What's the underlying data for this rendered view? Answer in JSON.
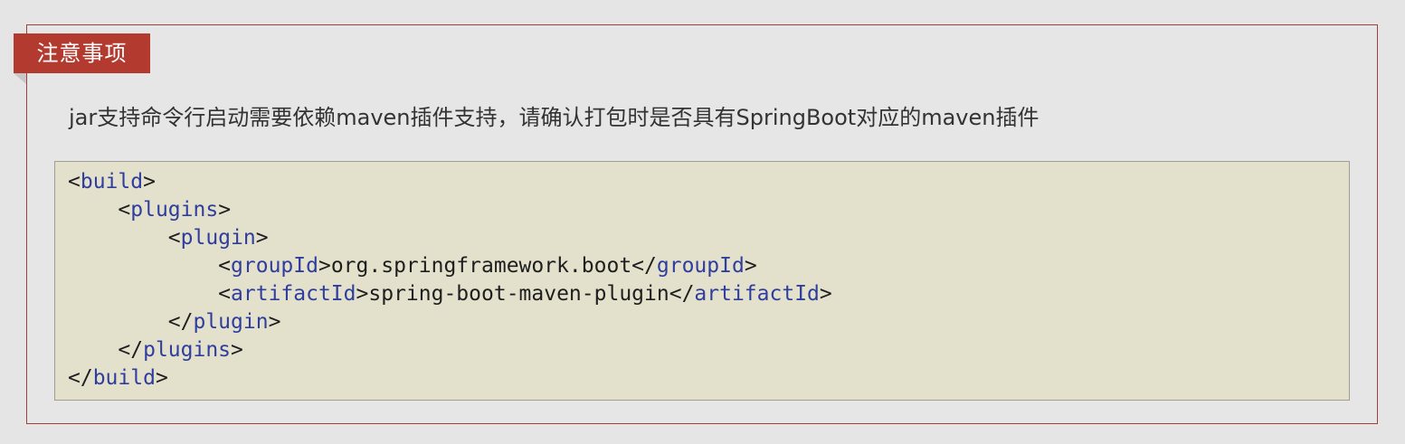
{
  "note": {
    "tab_label": "注意事项",
    "description": "jar支持命令行启动需要依赖maven插件支持，请确认打包时是否具有SpringBoot对应的maven插件"
  },
  "code": {
    "lines": [
      {
        "indent": "",
        "open": "<",
        "tag": "build",
        "mid": ">",
        "text": "",
        "close_open": "",
        "close_tag": "",
        "close_end": ""
      },
      {
        "indent": "    ",
        "open": "<",
        "tag": "plugins",
        "mid": ">",
        "text": "",
        "close_open": "",
        "close_tag": "",
        "close_end": ""
      },
      {
        "indent": "        ",
        "open": "<",
        "tag": "plugin",
        "mid": ">",
        "text": "",
        "close_open": "",
        "close_tag": "",
        "close_end": ""
      },
      {
        "indent": "            ",
        "open": "<",
        "tag": "groupId",
        "mid": ">",
        "text": "org.springframework.boot",
        "close_open": "</",
        "close_tag": "groupId",
        "close_end": ">"
      },
      {
        "indent": "            ",
        "open": "<",
        "tag": "artifactId",
        "mid": ">",
        "text": "spring-boot-maven-plugin",
        "close_open": "</",
        "close_tag": "artifactId",
        "close_end": ">"
      },
      {
        "indent": "        ",
        "open": "</",
        "tag": "plugin",
        "mid": ">",
        "text": "",
        "close_open": "",
        "close_tag": "",
        "close_end": ""
      },
      {
        "indent": "    ",
        "open": "</",
        "tag": "plugins",
        "mid": ">",
        "text": "",
        "close_open": "",
        "close_tag": "",
        "close_end": ""
      },
      {
        "indent": "",
        "open": "</",
        "tag": "build",
        "mid": ">",
        "text": "",
        "close_open": "",
        "close_tag": "",
        "close_end": ""
      }
    ]
  },
  "colors": {
    "tab_background": "#b33a2e",
    "box_border": "#a04040",
    "code_background": "#e3e0cc",
    "tag_name": "#2f3e9e",
    "text": "#333333"
  }
}
